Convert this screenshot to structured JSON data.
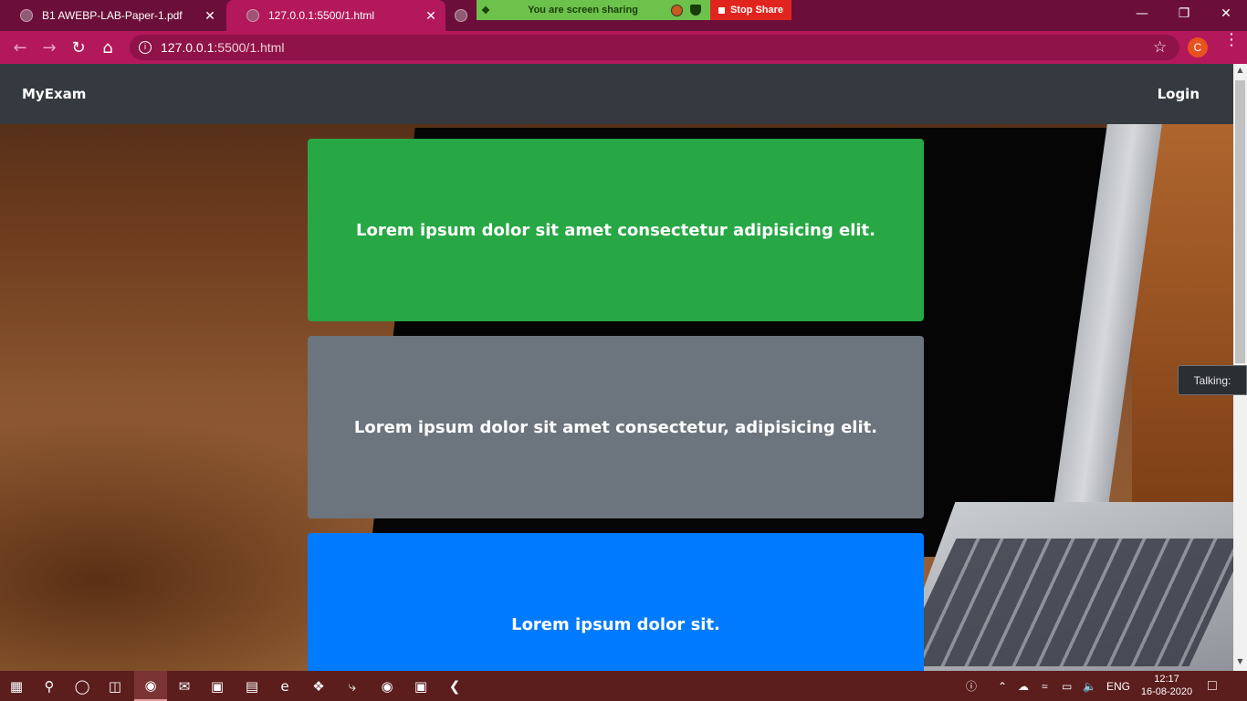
{
  "browser": {
    "tabs": [
      {
        "title": "B1 AWEBP-LAB-Paper-1.pdf",
        "close": "✕"
      },
      {
        "title": "127.0.0.1:5500/1.html",
        "close": "✕"
      },
      {
        "title": ""
      }
    ],
    "share_bar": {
      "message": "You are screen sharing",
      "stop_label": "Stop Share"
    },
    "url_host": "127.0.0.1",
    "url_rest": ":5500/1.html",
    "profile_initial": "C"
  },
  "page": {
    "brand": "MyExam",
    "login": "Login",
    "cards": [
      {
        "text": "Lorem ipsum dolor sit amet consectetur adipisicing elit.",
        "color": "#28a745"
      },
      {
        "text": "Lorem ipsum dolor sit amet consectetur, adipisicing elit.",
        "color": "#6c757d"
      },
      {
        "text": "Lorem ipsum dolor sit.",
        "color": "#007bff"
      }
    ]
  },
  "overlay": {
    "talking_label": "Talking:"
  },
  "taskbar": {
    "lang": "ENG",
    "time": "12:17",
    "date": "16-08-2020"
  }
}
